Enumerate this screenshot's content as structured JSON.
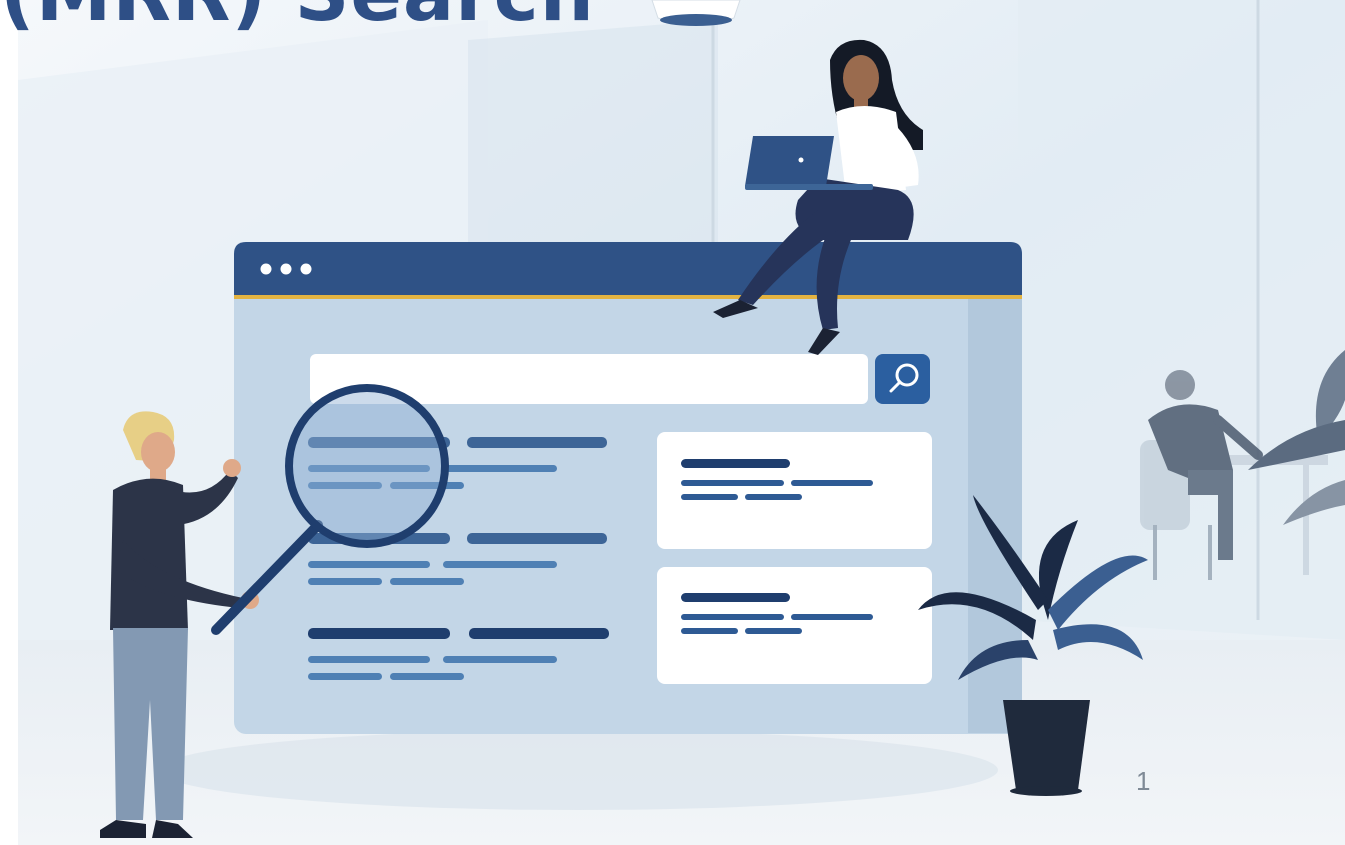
{
  "slide": {
    "title": "(MRR) Search",
    "page_number": "1"
  },
  "palette": {
    "title_color": "#2E4F86",
    "window_bar": "#2F5286",
    "window_accent": "#E3B341",
    "window_body": "#BFD4E6",
    "result_line_dark": "#1F3E6E",
    "result_line_light": "#4F80B4",
    "search_button": "#2B5FA0",
    "room_background": "#E4EEF5"
  },
  "illustration": {
    "search_button_icon": "magnifier-icon",
    "window_controls": 3
  }
}
